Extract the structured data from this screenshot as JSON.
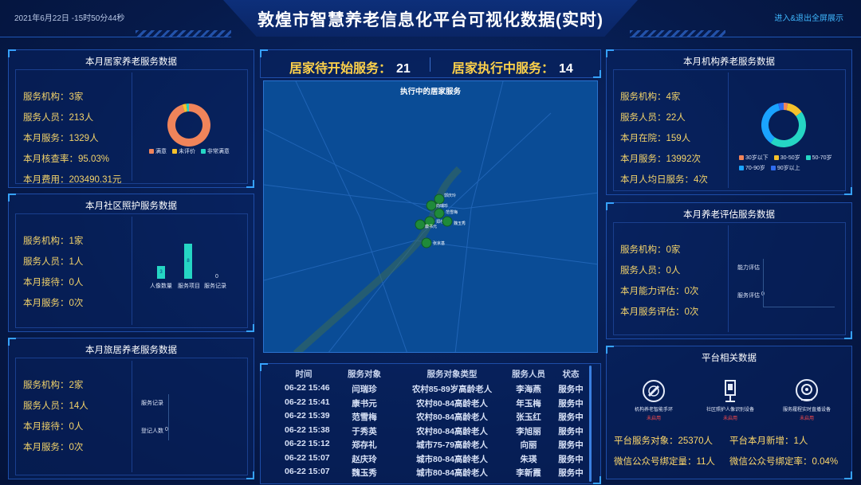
{
  "header": {
    "datetime": "2021年6月22日 -15时50分44秒",
    "title": "敦煌市智慧养老信息化平台可视化数据(实时)",
    "fullscreen_link": "进入&退出全屏展示"
  },
  "home_care": {
    "title": "本月居家养老服务数据",
    "stats": [
      "服务机构：3家",
      "服务人员：213人",
      "本月服务：1329人",
      "本月核查率：95.03%",
      "本月费用：203490.31元"
    ],
    "donut": {
      "legend": [
        "满意",
        "未评价",
        "非常满意"
      ],
      "values": [
        95,
        3,
        2
      ],
      "colors": [
        "#f0845a",
        "#f5c12b",
        "#25d6c4"
      ]
    }
  },
  "community_care": {
    "title": "本月社区照护服务数据",
    "stats": [
      "服务机构：1家",
      "服务人员：1人",
      "本月接待：0人",
      "本月服务：0次"
    ],
    "bars": [
      {
        "label": "人像数量",
        "value": "3"
      },
      {
        "label": "服务项目",
        "value": "8"
      },
      {
        "label": "服务记录",
        "value": "0"
      }
    ]
  },
  "travel_care": {
    "title": "本月旅居养老服务数据",
    "stats": [
      "服务机构：2家",
      "服务人员：14人",
      "本月接待：0人",
      "本月服务：0次"
    ],
    "rows": [
      {
        "label": "服务记录",
        "value": ""
      },
      {
        "label": "登记人数",
        "value": "0"
      }
    ]
  },
  "counters": {
    "pending_label": "居家待开始服务：",
    "pending_value": "21",
    "running_label": "居家执行中服务：",
    "running_value": "14"
  },
  "map": {
    "title": "执行中的居家服务",
    "markers": [
      "郭庆玲",
      "向瑞珍",
      "范雪梅",
      "郑存礼",
      "康书元",
      "魏玉秀",
      "张京基"
    ]
  },
  "service_table": {
    "headers": [
      "时间",
      "服务对象",
      "服务对象类型",
      "服务人员",
      "状态"
    ],
    "rows": [
      [
        "06-22 15:46",
        "闫瑞珍",
        "农村85-89岁高龄老人",
        "李海燕",
        "服务中"
      ],
      [
        "06-22 15:41",
        "康书元",
        "农村80-84高龄老人",
        "年玉梅",
        "服务中"
      ],
      [
        "06-22 15:39",
        "范雪梅",
        "农村80-84高龄老人",
        "张玉红",
        "服务中"
      ],
      [
        "06-22 15:38",
        "于秀英",
        "农村80-84高龄老人",
        "李旭丽",
        "服务中"
      ],
      [
        "06-22 15:12",
        "郑存礼",
        "城市75-79高龄老人",
        "向丽",
        "服务中"
      ],
      [
        "06-22 15:07",
        "赵庆玲",
        "城市80-84高龄老人",
        "朱瑛",
        "服务中"
      ],
      [
        "06-22 15:07",
        "魏玉秀",
        "城市80-84高龄老人",
        "李新霞",
        "服务中"
      ]
    ]
  },
  "institution_care": {
    "title": "本月机构养老服务数据",
    "stats": [
      "服务机构：4家",
      "服务人员：22人",
      "本月在院：159人",
      "本月服务：13992次",
      "本月人均日服务：4次"
    ],
    "donut": {
      "legend": [
        "30岁以下",
        "30-50岁",
        "50-70岁",
        "70-90岁",
        "90岁以上"
      ],
      "values": [
        3,
        12,
        45,
        36,
        4
      ],
      "colors": [
        "#f0845a",
        "#f5c12b",
        "#25d6c4",
        "#1aa3ff",
        "#2f6cf0"
      ]
    }
  },
  "assessment": {
    "title": "本月养老评估服务数据",
    "stats": [
      "服务机构：0家",
      "服务人员：0人",
      "本月能力评估：0次",
      "本月服务评估：0次"
    ],
    "rows": [
      {
        "label": "能力评估",
        "value": ""
      },
      {
        "label": "服务评估",
        "value": "0"
      }
    ]
  },
  "platform": {
    "title": "平台相关数据",
    "devices": [
      {
        "name": "机构养老智能手环",
        "status": "未启用"
      },
      {
        "name": "社区照护人像识别设备",
        "status": "未启用"
      },
      {
        "name": "服务履程实时直播设备",
        "status": "未启用"
      }
    ],
    "stats": [
      "平台服务对象：25370人",
      "平台本月新增：1人",
      "微信公众号绑定量：11人",
      "微信公众号绑定率：0.04%"
    ]
  }
}
